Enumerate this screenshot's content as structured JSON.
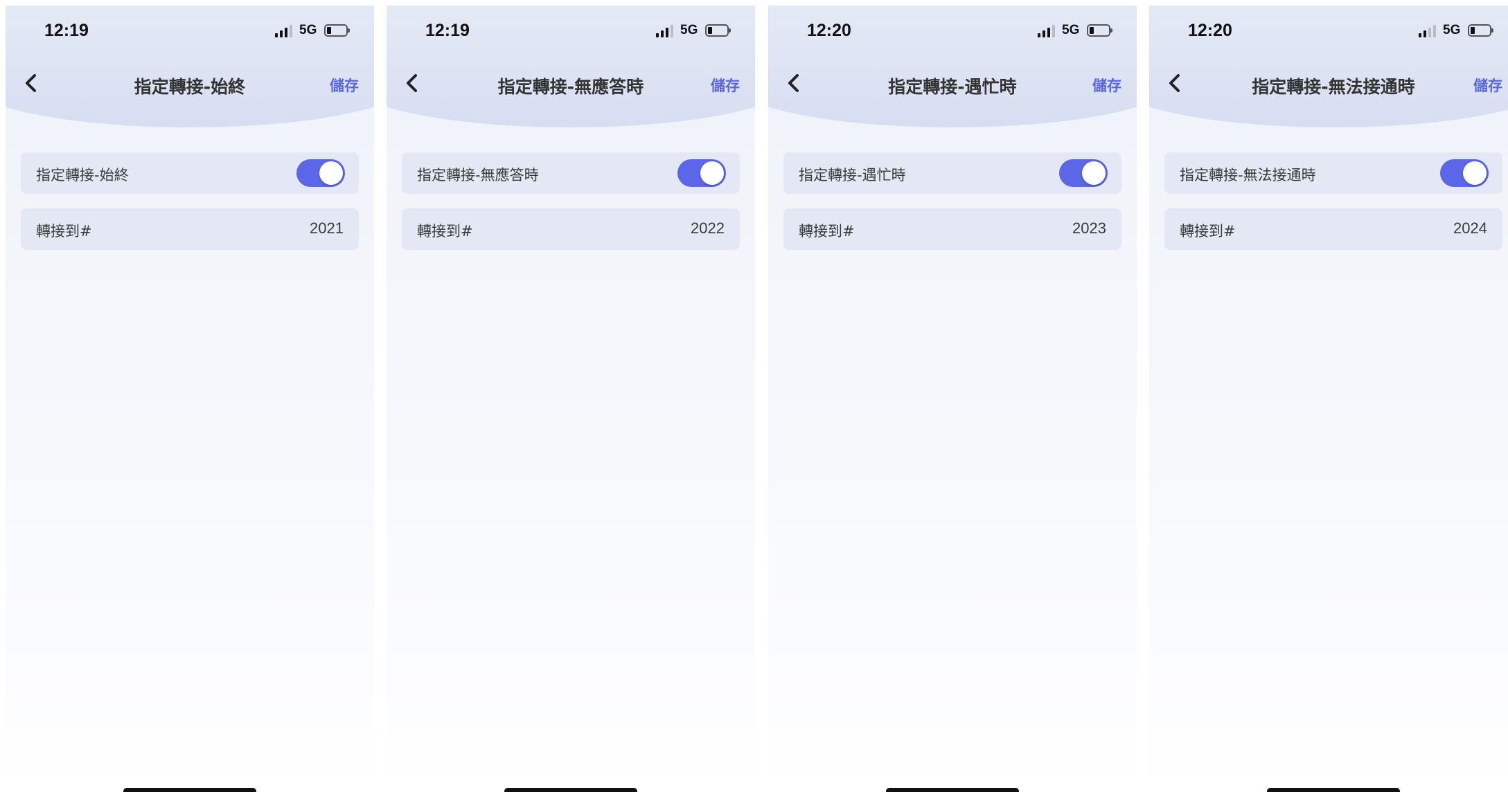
{
  "screens": [
    {
      "status": {
        "time": "12:19",
        "network": "5G"
      },
      "nav": {
        "back_icon": "chevron-left-icon",
        "title": "指定轉接-始終",
        "save_label": "儲存"
      },
      "toggle_row": {
        "label": "指定轉接-始終",
        "enabled": true
      },
      "forward_row": {
        "label": "轉接到#",
        "value": "2021"
      }
    },
    {
      "status": {
        "time": "12:19",
        "network": "5G"
      },
      "nav": {
        "back_icon": "chevron-left-icon",
        "title": "指定轉接-無應答時",
        "save_label": "儲存"
      },
      "toggle_row": {
        "label": "指定轉接-無應答時",
        "enabled": true
      },
      "forward_row": {
        "label": "轉接到#",
        "value": "2022"
      }
    },
    {
      "status": {
        "time": "12:20",
        "network": "5G"
      },
      "nav": {
        "back_icon": "chevron-left-icon",
        "title": "指定轉接-遇忙時",
        "save_label": "儲存"
      },
      "toggle_row": {
        "label": "指定轉接-遇忙時",
        "enabled": true
      },
      "forward_row": {
        "label": "轉接到#",
        "value": "2023"
      }
    },
    {
      "status": {
        "time": "12:20",
        "network": "5G"
      },
      "nav": {
        "back_icon": "chevron-left-icon",
        "title": "指定轉接-無法接通時",
        "save_label": "儲存"
      },
      "toggle_row": {
        "label": "指定轉接-無法接通時",
        "enabled": true
      },
      "forward_row": {
        "label": "轉接到#",
        "value": "2024"
      }
    }
  ],
  "colors": {
    "accent": "#5b67e6",
    "save_text": "#5b67e0",
    "card_bg": "#e3e8f4",
    "header_bg": "#d7def1"
  }
}
